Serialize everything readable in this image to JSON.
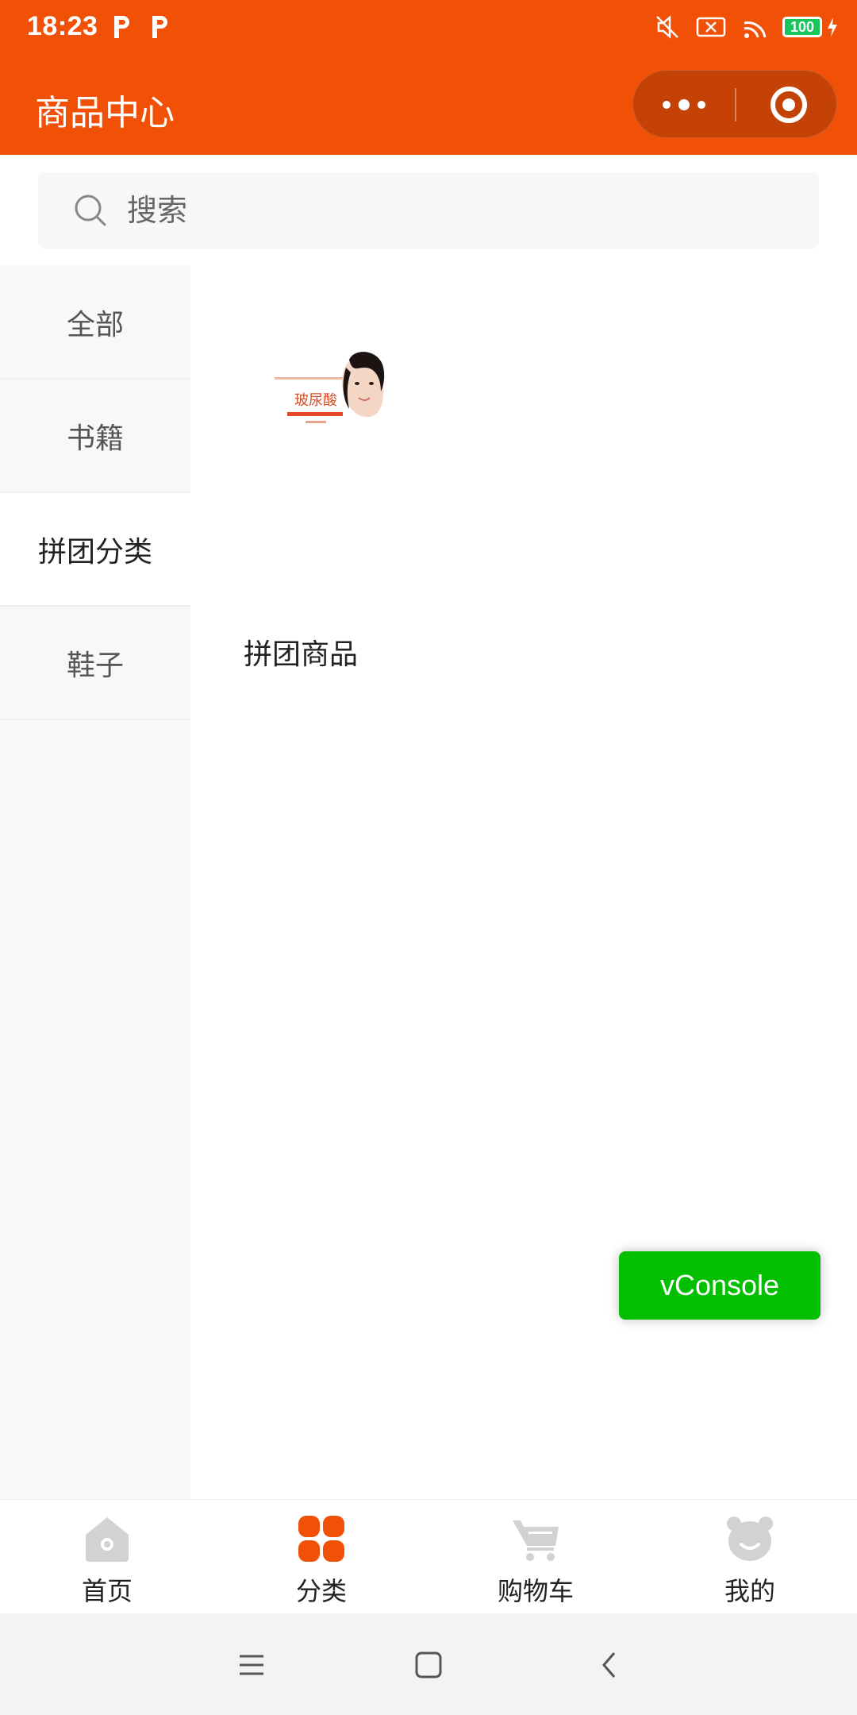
{
  "status_bar": {
    "time": "18:23",
    "battery": "100"
  },
  "header": {
    "title": "商品中心"
  },
  "search": {
    "placeholder": "搜索"
  },
  "sidebar": {
    "items": [
      {
        "label": "全部",
        "active": false
      },
      {
        "label": "书籍",
        "active": false
      },
      {
        "label": "拼团分类",
        "active": true
      },
      {
        "label": "鞋子",
        "active": false
      }
    ]
  },
  "content": {
    "products": [
      {
        "name": "拼团商品",
        "image_text": "玻尿酸"
      }
    ]
  },
  "vconsole": {
    "label": "vConsole"
  },
  "tabbar": {
    "items": [
      {
        "label": "首页",
        "icon": "home-icon",
        "active": false
      },
      {
        "label": "分类",
        "icon": "category-icon",
        "active": true
      },
      {
        "label": "购物车",
        "icon": "cart-icon",
        "active": false
      },
      {
        "label": "我的",
        "icon": "bear-profile-icon",
        "active": false
      }
    ]
  },
  "colors": {
    "brand": "#f15106",
    "capsule": "#c54207",
    "vconsole": "#04be02",
    "inactive_icon": "#d2d2d2"
  }
}
